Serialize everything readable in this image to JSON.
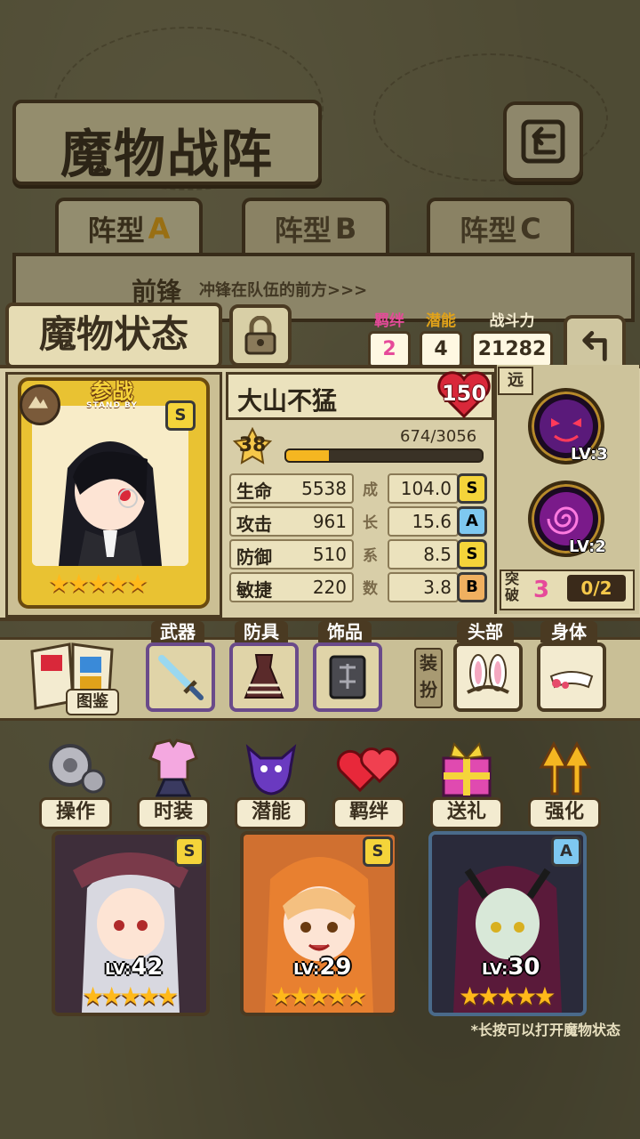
{
  "header": {
    "title": "魔物战阵"
  },
  "tabs": [
    {
      "label": "阵型",
      "suffix": "A",
      "active": true
    },
    {
      "label": "阵型",
      "suffix": "B",
      "active": false
    },
    {
      "label": "阵型",
      "suffix": "C",
      "active": false
    }
  ],
  "formation": {
    "position": "前锋",
    "description": "冲锋在队伍的前方>>>"
  },
  "status": {
    "title": "魔物状态",
    "bond": {
      "label": "羁绊",
      "value": "2",
      "color": "#e64a9a"
    },
    "potential": {
      "label": "潜能",
      "value": "4",
      "color": "#e0a21a"
    },
    "power": {
      "label": "战斗力",
      "value": "21282"
    }
  },
  "monster": {
    "name": "大山不猛",
    "heart_value": "150",
    "banner": "参战",
    "banner_sub": "STAND BY",
    "rank": "S",
    "stars": "★★★★★",
    "level": "38",
    "exp_text": "674/3056",
    "exp_fraction": 0.22,
    "stats": [
      {
        "label": "生命",
        "value": "5538",
        "growth": "104.0",
        "grade": "S"
      },
      {
        "label": "攻击",
        "value": "961",
        "growth": "15.6",
        "grade": "A"
      },
      {
        "label": "防御",
        "value": "510",
        "growth": "8.5",
        "grade": "S"
      },
      {
        "label": "敏捷",
        "value": "220",
        "growth": "3.8",
        "grade": "B"
      }
    ],
    "growth_label": [
      "成",
      "长",
      "系",
      "数"
    ]
  },
  "skills": {
    "range": "远",
    "items": [
      {
        "name": "demon-face-skill",
        "level": "LV:3"
      },
      {
        "name": "spiral-skill",
        "level": "LV:2"
      }
    ],
    "breakthrough_label": "突破",
    "breakthrough_level": "3",
    "breakthrough_progress": "0/2"
  },
  "equipment": {
    "book_label": "图鉴",
    "weapon": "武器",
    "armor": "防具",
    "accessory": "饰品",
    "dress_up": "装扮",
    "head": "头部",
    "body": "身体"
  },
  "actions": [
    "操作",
    "时装",
    "潜能",
    "羁绊",
    "送礼",
    "强化"
  ],
  "team": [
    {
      "level_prefix": "LV:",
      "level": "42",
      "rank": "S",
      "stars": "★★★★★"
    },
    {
      "level_prefix": "LV:",
      "level": "29",
      "rank": "S",
      "stars": "★★★★★"
    },
    {
      "level_prefix": "LV:",
      "level": "30",
      "rank": "A",
      "stars": "★★★★★"
    }
  ],
  "hint": "*长按可以打开魔物状态",
  "colors": {
    "grade_S": "#f4d43a",
    "grade_A": "#7ec8f0",
    "grade_B": "#f0b060"
  }
}
